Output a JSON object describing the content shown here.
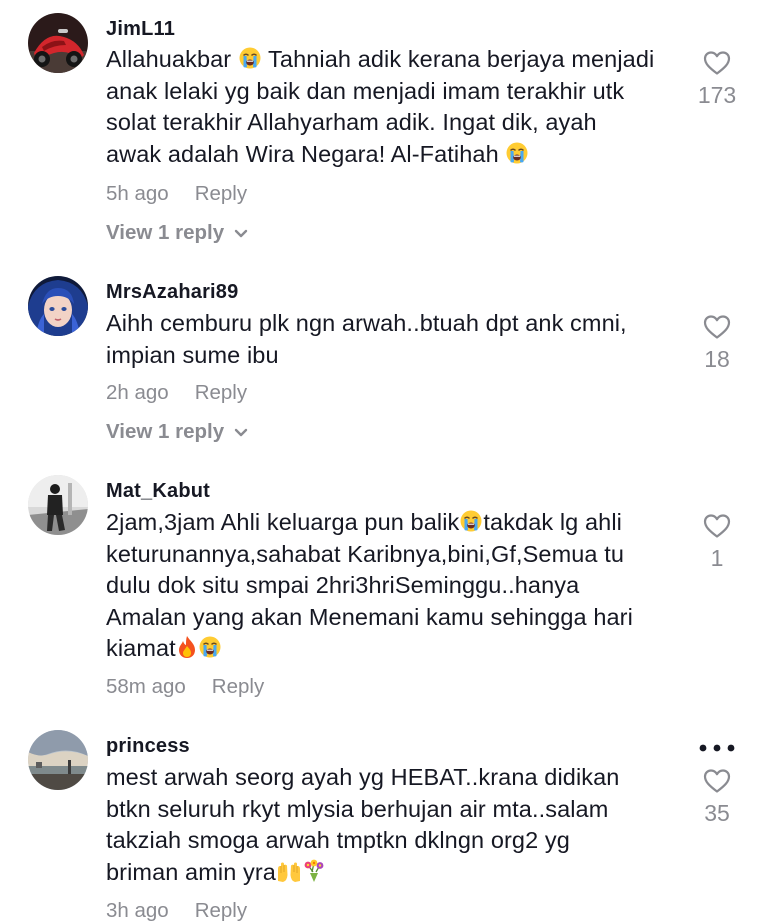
{
  "comments": [
    {
      "username": "JimL11",
      "lines": [
        "Allahuakbar {cry} Tahniah adik kerana berjaya menjadi",
        "anak lelaki yg baik dan menjadi imam terakhir utk",
        "solat terakhir Allahyarham adik. Ingat dik, ayah",
        "awak adalah Wira Negara! Al-Fatihah {cry}"
      ],
      "time": "5h ago",
      "reply_label": "Reply",
      "view_replies": "View 1 reply",
      "likes": "173"
    },
    {
      "username": "MrsAzahari89",
      "lines": [
        "Aihh cemburu plk ngn arwah..btuah dpt ank cmni,",
        "impian sume ibu"
      ],
      "time": "2h ago",
      "reply_label": "Reply",
      "view_replies": "View 1 reply",
      "likes": "18"
    },
    {
      "username": "Mat_Kabut",
      "lines": [
        "2jam,3jam Ahli keluarga pun balik{cry}takdak lg ahli",
        "keturunannya,sahabat Karibnya,bini,Gf,Semua tu",
        "dulu dok situ smpai 2hri3hriSeminggu..hanya",
        "Amalan yang akan Menemani kamu sehingga hari",
        "kiamat{fire}{cry}"
      ],
      "time": "58m ago",
      "reply_label": "Reply",
      "likes": "1"
    },
    {
      "username": "princess",
      "lines": [
        "mest arwah seorg ayah yg HEBAT..krana didikan",
        "btkn seluruh rkyt mlysia berhujan air mta..salam",
        "takziah smoga arwah tmptkn dklngn org2 yg",
        "briman amin yra{hands}{flowers}"
      ],
      "time": "3h ago",
      "reply_label": "Reply",
      "likes": "35"
    }
  ],
  "icons": {
    "like": "heart-outline-icon",
    "expand": "chevron-down-icon",
    "more": "more-dots-icon",
    "emojis": [
      "loudly-crying-face-icon",
      "fire-icon",
      "raising-hands-icon",
      "bouquet-icon"
    ]
  },
  "colors": {
    "text": "#161823",
    "secondary": "#8a8b91",
    "background": "#ffffff"
  }
}
